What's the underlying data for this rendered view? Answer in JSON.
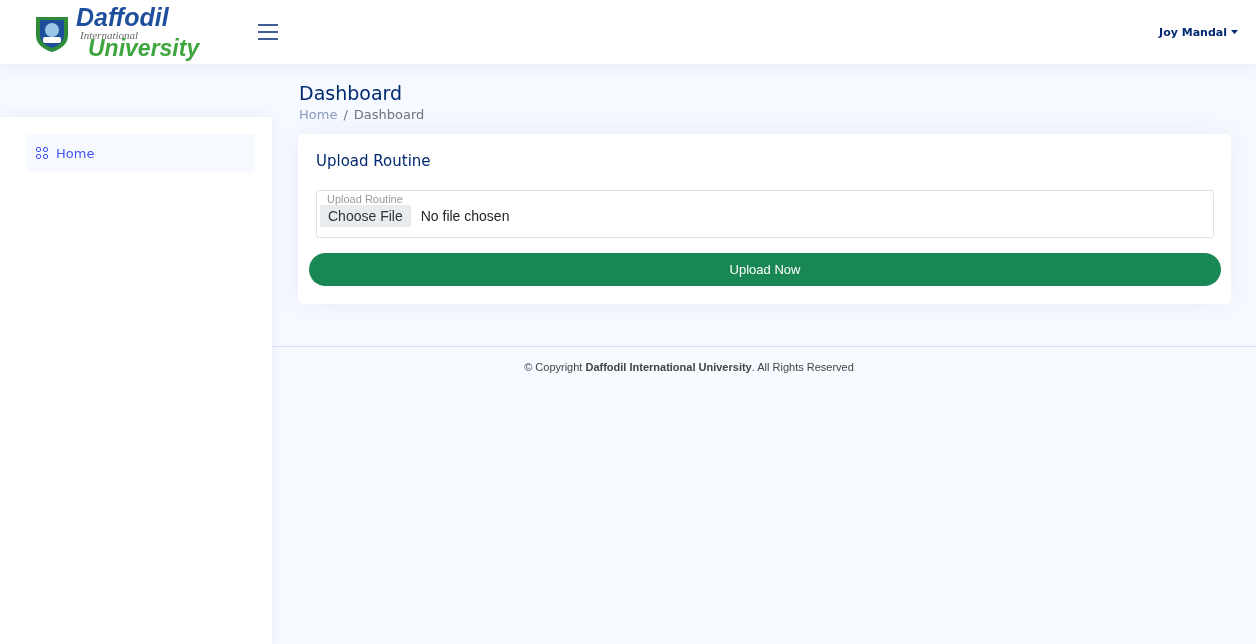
{
  "header": {
    "logo": {
      "line_1": "Daffodil",
      "line_2": "International",
      "line_3": "University"
    },
    "user": {
      "name": "Joy Mandal"
    }
  },
  "sidebar": {
    "items": [
      {
        "label": "Home",
        "selected": true
      }
    ]
  },
  "page": {
    "title": "Dashboard",
    "breadcrumb_separator": "/",
    "breadcrumb": [
      {
        "label": "Home",
        "kind": "link"
      },
      {
        "label": "Dashboard",
        "kind": "current"
      }
    ]
  },
  "card": {
    "title": "Upload Routine",
    "field": {
      "label": "Upload Routine",
      "button": "Choose File",
      "value": "No file chosen"
    },
    "submit": "Upload Now"
  },
  "footer": {
    "text": "© Copyright **Daffodil International University**. All Rights Reserved"
  }
}
